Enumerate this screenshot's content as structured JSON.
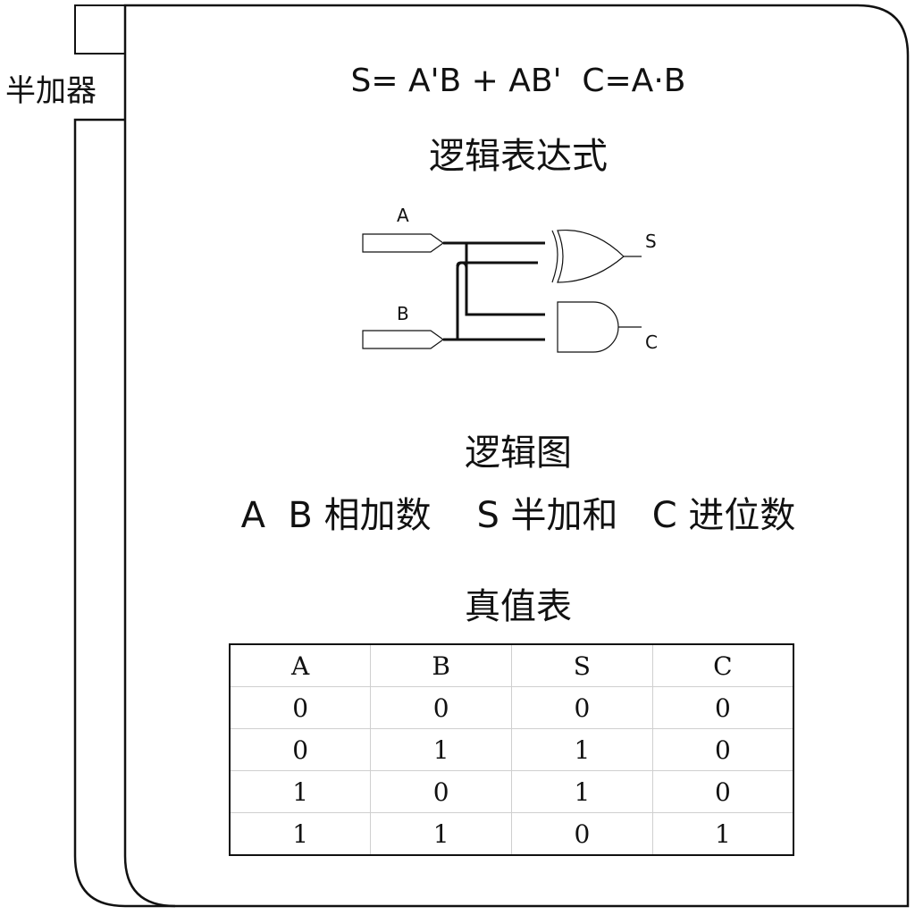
{
  "tab_label": "半加器",
  "formula": "S= A'B + AB'  C=A·B",
  "captions": {
    "expression": "逻辑表达式",
    "diagram": "逻辑图",
    "truth_table": "真值表"
  },
  "legend": "A  B 相加数    S 半加和   C 进位数",
  "circuit": {
    "input_a": "A",
    "input_b": "B",
    "output_s": "S",
    "output_c": "C",
    "gates": [
      "xor",
      "and"
    ]
  },
  "truth_table": {
    "headers": [
      "A",
      "B",
      "S",
      "C"
    ],
    "rows": [
      [
        "0",
        "0",
        "0",
        "0"
      ],
      [
        "0",
        "1",
        "1",
        "0"
      ],
      [
        "1",
        "0",
        "1",
        "0"
      ],
      [
        "1",
        "1",
        "0",
        "1"
      ]
    ]
  }
}
